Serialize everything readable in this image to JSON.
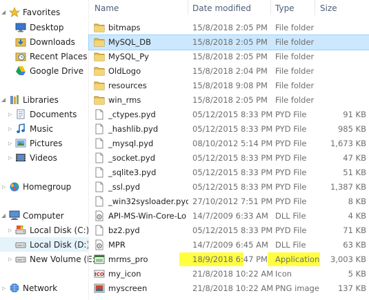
{
  "sidebar": {
    "favorites": {
      "label": "Favorites",
      "items": [
        "Desktop",
        "Downloads",
        "Recent Places",
        "Google Drive"
      ]
    },
    "libraries": {
      "label": "Libraries",
      "items": [
        "Documents",
        "Music",
        "Pictures",
        "Videos"
      ]
    },
    "homegroup": {
      "label": "Homegroup"
    },
    "computer": {
      "label": "Computer",
      "items": [
        "Local Disk (C:)",
        "Local Disk (D:)",
        "New Volume (E:)"
      ]
    },
    "network": {
      "label": "Network"
    }
  },
  "columns": {
    "name": "Name",
    "date": "Date modified",
    "type": "Type",
    "size": "Size"
  },
  "files": [
    {
      "name": "bitmaps",
      "date": "15/8/2018 2:05 PM",
      "type": "File folder",
      "size": "",
      "icon": "folder-icon"
    },
    {
      "name": "MySQL_DB",
      "date": "15/8/2018 2:05 PM",
      "type": "File folder",
      "size": "",
      "icon": "folder-icon"
    },
    {
      "name": "MySQL_Py",
      "date": "15/8/2018 2:05 PM",
      "type": "File folder",
      "size": "",
      "icon": "folder-icon"
    },
    {
      "name": "OldLogo",
      "date": "15/8/2018 2:04 PM",
      "type": "File folder",
      "size": "",
      "icon": "folder-icon"
    },
    {
      "name": "resources",
      "date": "15/8/2018 9:08 PM",
      "type": "File folder",
      "size": "",
      "icon": "folder-icon"
    },
    {
      "name": "win_rms",
      "date": "15/8/2018 2:05 PM",
      "type": "File folder",
      "size": "",
      "icon": "folder-icon"
    },
    {
      "name": "_ctypes.pyd",
      "date": "05/12/2015 8:33 PM",
      "type": "PYD File",
      "size": "91 KB",
      "icon": "file-icon"
    },
    {
      "name": "_hashlib.pyd",
      "date": "05/12/2015 8:33 PM",
      "type": "PYD File",
      "size": "985 KB",
      "icon": "file-icon"
    },
    {
      "name": "_mysql.pyd",
      "date": "08/10/2012 5:14 PM",
      "type": "PYD File",
      "size": "1,673 KB",
      "icon": "file-icon"
    },
    {
      "name": "_socket.pyd",
      "date": "05/12/2015 8:33 PM",
      "type": "PYD File",
      "size": "47 KB",
      "icon": "file-icon"
    },
    {
      "name": "_sqlite3.pyd",
      "date": "05/12/2015 8:33 PM",
      "type": "PYD File",
      "size": "51 KB",
      "icon": "file-icon"
    },
    {
      "name": "_ssl.pyd",
      "date": "05/12/2015 8:33 PM",
      "type": "PYD File",
      "size": "1,387 KB",
      "icon": "file-icon"
    },
    {
      "name": "_win32sysloader.pyd",
      "date": "27/10/2012 7:51 PM",
      "type": "PYD File",
      "size": "8 KB",
      "icon": "file-icon"
    },
    {
      "name": "API-MS-Win-Core-Lo",
      "date": "14/7/2009 6:33 AM",
      "type": "DLL File",
      "size": "4 KB",
      "icon": "dll-icon"
    },
    {
      "name": "bz2.pyd",
      "date": "05/12/2015 8:33 PM",
      "type": "PYD File",
      "size": "71 KB",
      "icon": "file-icon"
    },
    {
      "name": "MPR",
      "date": "14/7/2009 6:45 AM",
      "type": "DLL File",
      "size": "63 KB",
      "icon": "dll-icon"
    },
    {
      "name": "mrms_pro",
      "date": "18/9/2018 6:47 PM",
      "type": "Application",
      "size": "3,003 KB",
      "icon": "application-icon"
    },
    {
      "name": "my_icon",
      "date": "21/8/2018 10:22 AM",
      "type": "Icon",
      "size": "5 KB",
      "icon": "ico-file-icon"
    },
    {
      "name": "myscreen",
      "date": "21/8/2018 10:22 AM",
      "type": "PNG image",
      "size": "137 KB",
      "icon": "image-icon"
    }
  ],
  "colors": {
    "highlight": "#ffff40",
    "selection": "#cce8ff",
    "header_text": "#4c607a",
    "folder": "#e8c050"
  }
}
